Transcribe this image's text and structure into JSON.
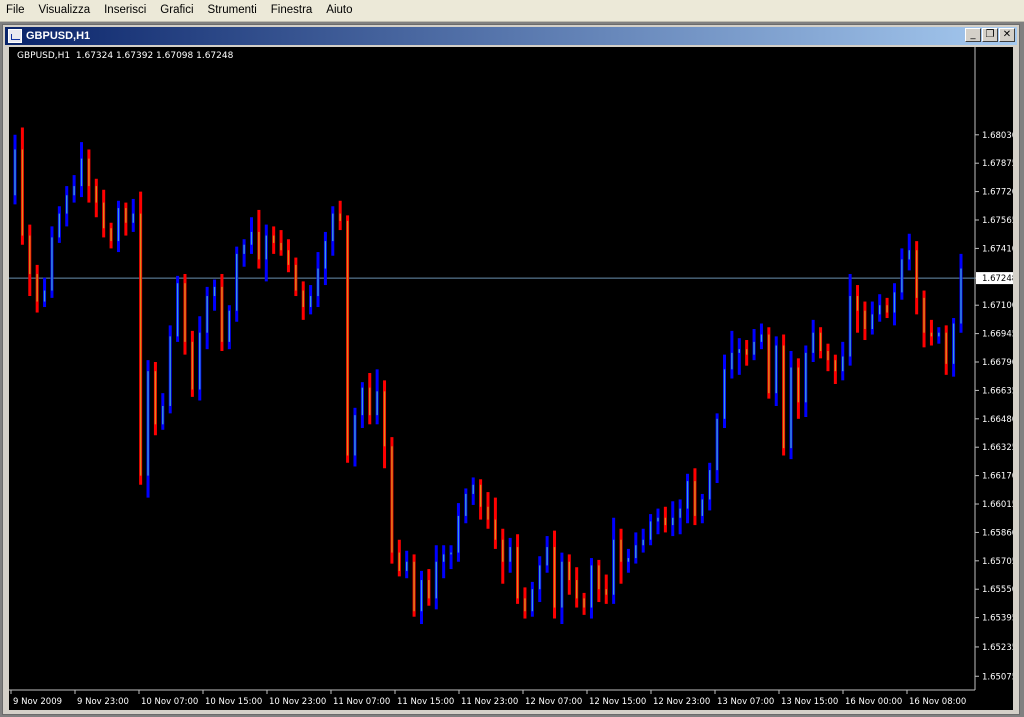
{
  "menubar": {
    "items": [
      "File",
      "Visualizza",
      "Inserisci",
      "Grafici",
      "Strumenti",
      "Finestra",
      "Aiuto"
    ]
  },
  "window": {
    "title": "GBPUSD,H1",
    "buttons": [
      "minimize",
      "restore",
      "close"
    ]
  },
  "chart_header": "GBPUSD,H1  1.67324 1.67392 1.67098 1.67248",
  "colors": {
    "background": "#000000",
    "up_bar": "#0000ff",
    "down_bar": "#ff0000",
    "up_body": "#3a9ad9",
    "down_body": "#d98a1c",
    "bid_line": "#6a8fb0",
    "axis_text": "#ffffff"
  },
  "chart_data": {
    "type": "candlestick",
    "symbol": "GBPUSD",
    "timeframe": "H1",
    "last_price": "1.67248",
    "y_ticks": [
      "1.68030",
      "1.67875",
      "1.67720",
      "1.67565",
      "1.67410",
      "1.67248",
      "1.67100",
      "1.66945",
      "1.66790",
      "1.66635",
      "1.66480",
      "1.66325",
      "1.66170",
      "1.66015",
      "1.65860",
      "1.65705",
      "1.65550",
      "1.65395",
      "1.65235",
      "1.65075"
    ],
    "ylim": [
      1.65,
      1.684
    ],
    "x_ticks": [
      "9 Nov 2009",
      "9 Nov 23:00",
      "10 Nov 07:00",
      "10 Nov 15:00",
      "10 Nov 23:00",
      "11 Nov 07:00",
      "11 Nov 15:00",
      "11 Nov 23:00",
      "12 Nov 07:00",
      "12 Nov 15:00",
      "12 Nov 23:00",
      "13 Nov 07:00",
      "13 Nov 15:00",
      "16 Nov 00:00",
      "16 Nov 08:00"
    ],
    "closes": [
      1.6795,
      1.6748,
      1.6727,
      1.6712,
      1.6718,
      1.6747,
      1.676,
      1.677,
      1.6775,
      1.679,
      1.6775,
      1.6766,
      1.6752,
      1.6745,
      1.6763,
      1.6755,
      1.676,
      1.6617,
      1.6674,
      1.6645,
      1.6655,
      1.6693,
      1.6722,
      1.669,
      1.6664,
      1.6695,
      1.6715,
      1.672,
      1.669,
      1.6707,
      1.6738,
      1.6743,
      1.675,
      1.6735,
      1.6748,
      1.6744,
      1.674,
      1.6732,
      1.6718,
      1.6709,
      1.6715,
      1.673,
      1.6745,
      1.676,
      1.6756,
      1.6628,
      1.665,
      1.6665,
      1.665,
      1.6663,
      1.6633,
      1.6575,
      1.6565,
      1.657,
      1.6543,
      1.656,
      1.655,
      1.657,
      1.6574,
      1.6575,
      1.6595,
      1.6607,
      1.6612,
      1.66,
      1.6593,
      1.6582,
      1.657,
      1.6578,
      1.655,
      1.6543,
      1.6555,
      1.6568,
      1.6578,
      1.6545,
      1.657,
      1.656,
      1.655,
      1.6545,
      1.6568,
      1.6555,
      1.6552,
      1.6582,
      1.657,
      1.6572,
      1.6579,
      1.6582,
      1.6592,
      1.6594,
      1.659,
      1.6594,
      1.6599,
      1.6614,
      1.6595,
      1.6604,
      1.662,
      1.6648,
      1.6675,
      1.6684,
      1.6686,
      1.6683,
      1.669,
      1.6694,
      1.6662,
      1.6688,
      1.6632,
      1.6676,
      1.6657,
      1.6684,
      1.6695,
      1.6685,
      1.668,
      1.6674,
      1.6682,
      1.6715,
      1.6707,
      1.6697,
      1.6705,
      1.671,
      1.6706,
      1.6717,
      1.6735,
      1.674,
      1.6714,
      1.6695,
      1.6693,
      1.6695,
      1.6678,
      1.67,
      1.673
    ]
  }
}
